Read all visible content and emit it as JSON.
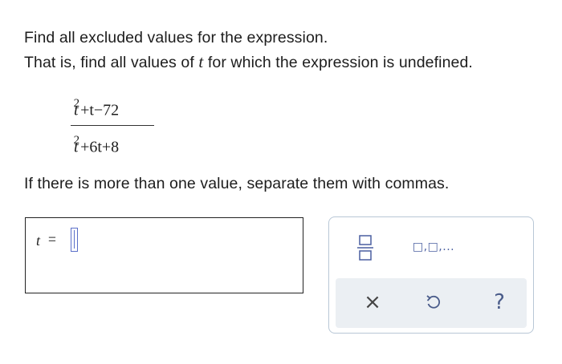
{
  "question": {
    "line1": "Find all excluded values for the expression.",
    "line2_before": "That is, find all values of ",
    "line2_var": "t",
    "line2_after": " for which the expression is undefined.",
    "line3": "If there is more than one value, separate them with commas."
  },
  "expression": {
    "numerator": {
      "t": "t",
      "exp": "2",
      "rest": "+t−72"
    },
    "denominator": {
      "t": "t",
      "exp": "2",
      "rest": "+6t+8"
    }
  },
  "answer": {
    "variable": "t",
    "equals": "=",
    "value": ""
  },
  "palette": {
    "fraction_icon": "fraction-icon",
    "list_label": "□,□,...",
    "clear_symbol": "×",
    "undo_icon": "undo-icon",
    "help_symbol": "?"
  },
  "colors": {
    "cursor": "#5a6fc9",
    "palette_border": "#b8c7d6",
    "palette_bottom_bg": "#ebeff3",
    "icon_blue": "#4a5fa0"
  }
}
